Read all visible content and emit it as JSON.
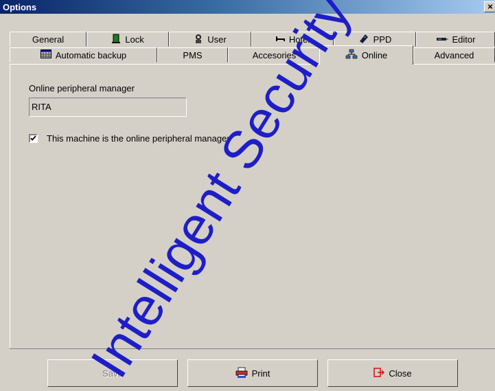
{
  "window": {
    "title": "Options",
    "close_glyph": "×"
  },
  "tabs_row1": [
    {
      "label": "General",
      "icon": ""
    },
    {
      "label": "Lock",
      "icon": "door-icon"
    },
    {
      "label": "User",
      "icon": "user-icon"
    },
    {
      "label": "Hotel",
      "icon": "bed-icon"
    },
    {
      "label": "PPD",
      "icon": "ppd-device-icon"
    },
    {
      "label": "Editor",
      "icon": "editor-device-icon"
    }
  ],
  "tabs_row2": [
    {
      "label": "Automatic backup",
      "icon": "calendar-icon"
    },
    {
      "label": "PMS",
      "icon": ""
    },
    {
      "label": "Accesories",
      "icon": ""
    },
    {
      "label": "Online",
      "icon": "network-icon",
      "active": true
    },
    {
      "label": "Advanced",
      "icon": ""
    }
  ],
  "online": {
    "manager_label": "Online peripheral manager",
    "manager_value": "RITA",
    "checkbox_label": "This machine is the online peripheral manager",
    "checkbox_checked": true
  },
  "buttons": {
    "save": "Save",
    "print": "Print",
    "close": "Close"
  },
  "colors": {
    "title_start": "#0a246a",
    "title_end": "#a6caf0",
    "face": "#d4d0c8",
    "watermark": "#1e1ec8"
  },
  "watermark": {
    "text": "Intelligent Security &"
  }
}
